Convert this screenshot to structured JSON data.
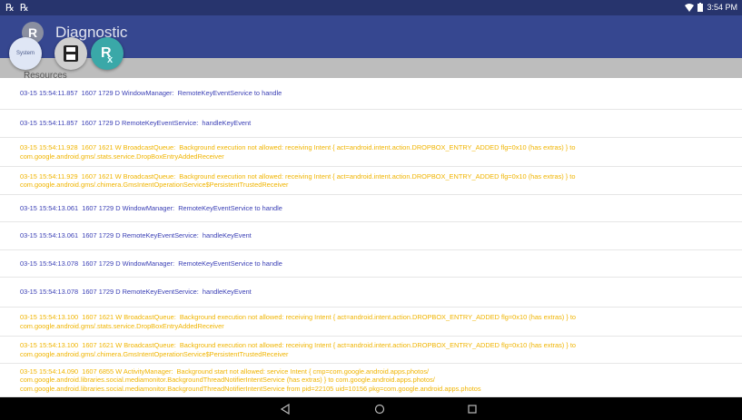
{
  "status_bar": {
    "left_icons": [
      "app-notification-icon",
      "rx-notification-icon"
    ],
    "time": "3:54 PM"
  },
  "app_bar": {
    "avatar_letter": "R",
    "title": "Diagnostic"
  },
  "sub_bar": {
    "label": "Resources"
  },
  "floating_buttons": {
    "system_label": "System"
  },
  "logs": [
    {
      "level": "D",
      "text": "03-15 15:54:11.857  1607 1729 D WindowManager:  RemoteKeyEventService to handle"
    },
    {
      "level": "D",
      "text": "03-15 15:54:11.857  1607 1729 D RemoteKeyEventService:  handleKeyEvent"
    },
    {
      "level": "W",
      "text": "03-15 15:54:11.928  1607 1621 W BroadcastQueue:  Background execution not allowed: receiving Intent { act=android.intent.action.DROPBOX_ENTRY_ADDED flg=0x10 (has extras) } to\ncom.google.android.gms/.stats.service.DropBoxEntryAddedReceiver"
    },
    {
      "level": "W",
      "text": "03-15 15:54:11.929  1607 1621 W BroadcastQueue:  Background execution not allowed: receiving Intent { act=android.intent.action.DROPBOX_ENTRY_ADDED flg=0x10 (has extras) } to\ncom.google.android.gms/.chimera.GmsIntentOperationService$PersistentTrustedReceiver"
    },
    {
      "level": "D",
      "text": "03-15 15:54:13.061  1607 1729 D WindowManager:  RemoteKeyEventService to handle"
    },
    {
      "level": "D",
      "text": "03-15 15:54:13.061  1607 1729 D RemoteKeyEventService:  handleKeyEvent"
    },
    {
      "level": "D",
      "text": "03-15 15:54:13.078  1607 1729 D WindowManager:  RemoteKeyEventService to handle"
    },
    {
      "level": "D",
      "text": "03-15 15:54:13.078  1607 1729 D RemoteKeyEventService:  handleKeyEvent"
    },
    {
      "level": "W",
      "text": "03-15 15:54:13.100  1607 1621 W BroadcastQueue:  Background execution not allowed: receiving Intent { act=android.intent.action.DROPBOX_ENTRY_ADDED flg=0x10 (has extras) } to\ncom.google.android.gms/.stats.service.DropBoxEntryAddedReceiver"
    },
    {
      "level": "W",
      "text": "03-15 15:54:13.100  1607 1621 W BroadcastQueue:  Background execution not allowed: receiving Intent { act=android.intent.action.DROPBOX_ENTRY_ADDED flg=0x10 (has extras) } to\ncom.google.android.gms/.chimera.GmsIntentOperationService$PersistentTrustedReceiver"
    },
    {
      "level": "W",
      "text": "03-15 15:54:14.090  1607 6855 W ActivityManager:  Background start not allowed: service Intent { cmp=com.google.android.apps.photos/\ncom.google.android.libraries.social.mediamonitor.BackgroundThreadNotifierIntentService (has extras) } to com.google.android.apps.photos/\ncom.google.android.libraries.social.mediamonitor.BackgroundThreadNotifierIntentService from pid=22105 uid=10156 pkg=com.google.android.apps.photos"
    }
  ],
  "colors": {
    "debug": "#3a3fb5",
    "warn": "#f0b400",
    "app_bar": "#364790",
    "status_bar": "#27346d"
  }
}
